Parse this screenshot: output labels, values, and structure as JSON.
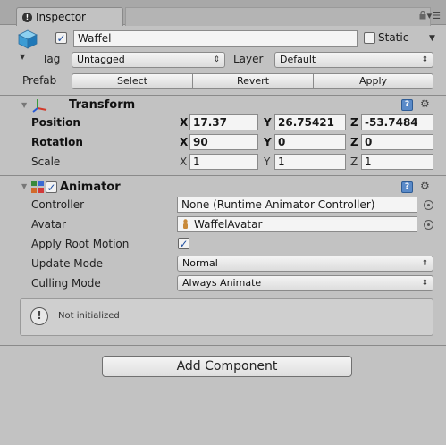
{
  "tab": {
    "label": "Inspector"
  },
  "header": {
    "active": true,
    "name": "Waffel",
    "static_label": "Static",
    "static_checked": false,
    "tag_label": "Tag",
    "tag_value": "Untagged",
    "layer_label": "Layer",
    "layer_value": "Default",
    "prefab_label": "Prefab",
    "prefab_select": "Select",
    "prefab_revert": "Revert",
    "prefab_apply": "Apply"
  },
  "transform": {
    "title": "Transform",
    "position_label": "Position",
    "rotation_label": "Rotation",
    "scale_label": "Scale",
    "axis_x": "X",
    "axis_y": "Y",
    "axis_z": "Z",
    "position": {
      "x": "17.37",
      "y": "26.75421",
      "z": "-53.7484"
    },
    "rotation": {
      "x": "90",
      "y": "0",
      "z": "0"
    },
    "scale": {
      "x": "1",
      "y": "1",
      "z": "1"
    }
  },
  "animator": {
    "title": "Animator",
    "enabled": true,
    "controller_label": "Controller",
    "controller_value": "None (Runtime Animator Controller)",
    "avatar_label": "Avatar",
    "avatar_value": "WaffelAvatar",
    "apply_root_motion_label": "Apply Root Motion",
    "apply_root_motion": true,
    "update_mode_label": "Update Mode",
    "update_mode_value": "Normal",
    "culling_mode_label": "Culling Mode",
    "culling_mode_value": "Always Animate",
    "notice_text": "Not initialized"
  },
  "add_component_label": "Add Component",
  "icons": {
    "tab": "info-icon",
    "lock": "lock-icon",
    "menu": "menu-icon",
    "object": "cube-icon",
    "transform": "transform-icon",
    "animator": "animator-icon",
    "help": "help-icon",
    "gear": "gear-icon",
    "picker": "object-picker-icon",
    "notice": "info-circle-icon"
  },
  "colors": {
    "background": "#c2c2c2",
    "help_icon": "#5a8ac8",
    "checkbox_check": "#1f4fa0"
  }
}
